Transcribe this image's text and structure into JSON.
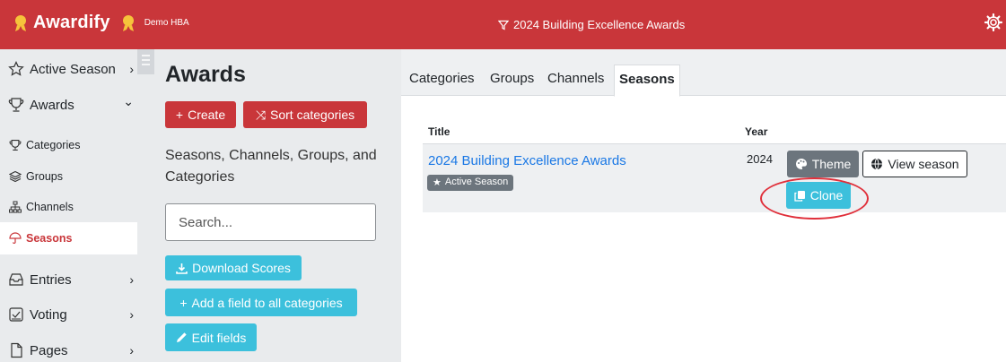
{
  "app": {
    "name": "Awardify",
    "org": "Demo HBA",
    "season_title": "2024 Building Excellence Awards",
    "brand_color": "#c9363a",
    "icons": {
      "medal": "medal-icon",
      "filter": "filter-icon",
      "settings": "gear-icon"
    }
  },
  "sidebar": {
    "items": [
      {
        "label": "Active Season",
        "icon": "star-icon",
        "chevron": "›"
      },
      {
        "label": "Awards",
        "icon": "trophy-icon",
        "chevron": "⌄"
      },
      {
        "label": "Categories",
        "icon": "trophy-icon"
      },
      {
        "label": "Groups",
        "icon": "layers-icon"
      },
      {
        "label": "Channels",
        "icon": "diagram-icon"
      },
      {
        "label": "Seasons",
        "icon": "umbrella-icon",
        "active": true
      },
      {
        "label": "Entries",
        "icon": "inbox-icon",
        "chevron": "›"
      },
      {
        "label": "Voting",
        "icon": "check-square-icon",
        "chevron": "›"
      },
      {
        "label": "Pages",
        "icon": "file-icon",
        "chevron": "›"
      }
    ]
  },
  "main": {
    "title": "Awards",
    "create_label": "Create",
    "sort_label": "Sort categories",
    "description": "Seasons, Channels, Groups, and Categories",
    "search_placeholder": "Search...",
    "download_label": "Download Scores",
    "add_field_label": "Add a field to all categories",
    "edit_fields_label": "Edit fields"
  },
  "tabs": [
    {
      "label": "Categories"
    },
    {
      "label": "Groups"
    },
    {
      "label": "Channels"
    },
    {
      "label": "Seasons",
      "active": true
    }
  ],
  "table": {
    "headers": {
      "title": "Title",
      "year": "Year"
    },
    "rows": [
      {
        "title": "2024 Building Excellence Awards",
        "badge": "Active Season",
        "year": "2024",
        "theme_label": "Theme",
        "view_label": "View season",
        "clone_label": "Clone"
      }
    ]
  },
  "colors": {
    "accent_red": "#c9363a",
    "teal": "#3cc0dc",
    "link_blue": "#1a78e5",
    "highlight": "#e0303b"
  }
}
